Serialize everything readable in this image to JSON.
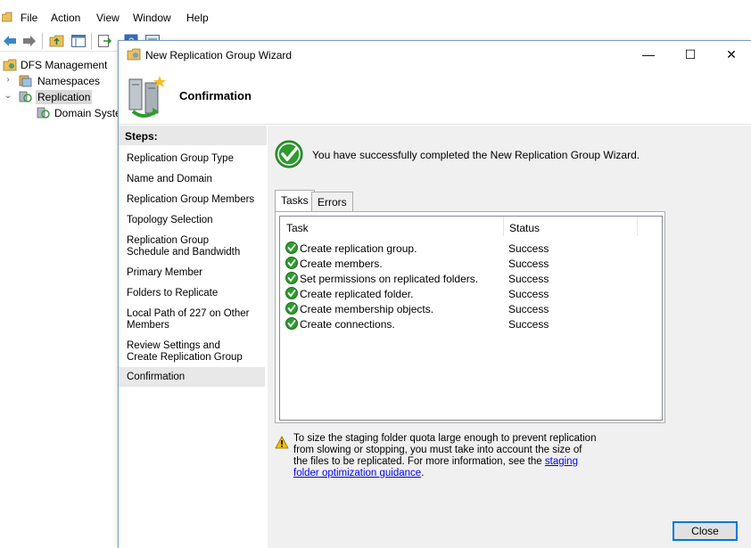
{
  "menubar": {
    "items": [
      "File",
      "Action",
      "View",
      "Window",
      "Help"
    ]
  },
  "tree": {
    "root": "DFS Management",
    "namespaces": "Namespaces",
    "replication": "Replication",
    "domain_system": "Domain System"
  },
  "wizard": {
    "title": "New Replication Group Wizard",
    "page_title": "Confirmation",
    "window_controls": {
      "minimize": "—",
      "maximize": "☐",
      "close": "✕"
    },
    "steps_heading": "Steps:",
    "steps": [
      "Replication Group Type",
      "Name and Domain",
      "Replication Group Members",
      "Topology Selection",
      "Replication Group Schedule and Bandwidth",
      "Primary Member",
      "Folders to Replicate",
      "Local Path of 227 on Other Members",
      "Review Settings and Create Replication Group",
      "Confirmation"
    ],
    "current_step": "Confirmation",
    "success_message": "You have successfully completed the New Replication Group Wizard.",
    "tabs": [
      "Tasks",
      "Errors"
    ],
    "active_tab": "Tasks",
    "columns": {
      "task": "Task",
      "status": "Status"
    },
    "tasks": [
      {
        "name": "Create replication group.",
        "status": "Success"
      },
      {
        "name": "Create members.",
        "status": "Success"
      },
      {
        "name": "Set permissions on replicated folders.",
        "status": "Success"
      },
      {
        "name": "Create replicated folder.",
        "status": "Success"
      },
      {
        "name": "Create membership objects.",
        "status": "Success"
      },
      {
        "name": "Create connections.",
        "status": "Success"
      }
    ],
    "warning": {
      "text": "To size the staging folder quota large enough to prevent replication from slowing or stopping, you must take into account the size of the files to be replicated. For more information, see the ",
      "link": "staging folder optimization guidance",
      "suffix": "."
    },
    "close_label": "Close"
  },
  "colors": {
    "accent": "#0078d7",
    "success_green": "#2e9b2e",
    "link": "#0000ee",
    "warning_yellow": "#f2c200"
  }
}
